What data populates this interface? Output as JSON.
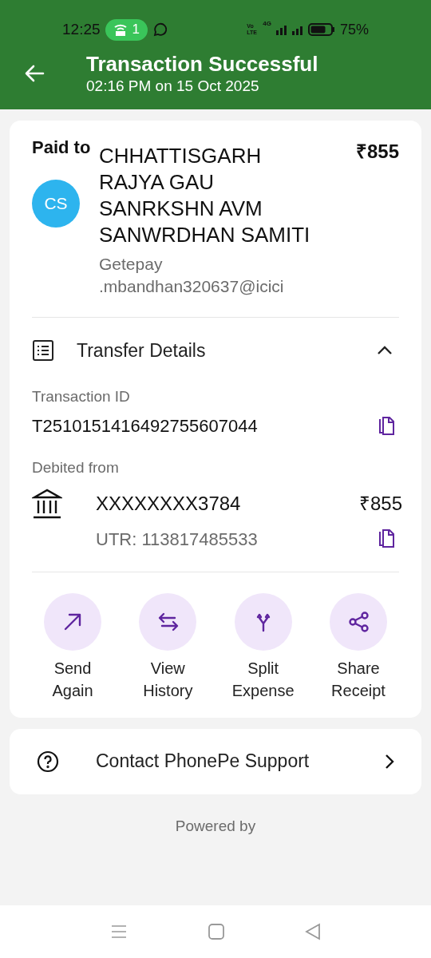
{
  "status_bar": {
    "time": "12:25",
    "hotspot_count": "1",
    "volte": "Vo LTE",
    "network": "4G",
    "battery": "75%"
  },
  "header": {
    "title": "Transaction Successful",
    "subtitle": "02:16 PM on 15 Oct 2025"
  },
  "payee": {
    "label": "Paid to",
    "initials": "CS",
    "name": "CHHATTISGARH RAJYA GAU SANRKSHN AVM SANWRDHAN SAMITI",
    "upi_id": "Getepay .mbandhan320637@icici",
    "amount": "₹855"
  },
  "transfer_details": {
    "title": "Transfer Details",
    "expanded": true,
    "transaction_id_label": "Transaction ID",
    "transaction_id": "T2510151416492755607044",
    "debited_label": "Debited from",
    "account": "XXXXXXXX3784",
    "amount": "₹855",
    "utr": "UTR: 113817485533"
  },
  "actions": [
    {
      "kind": "send",
      "label": "Send Again"
    },
    {
      "kind": "history",
      "label": "View History"
    },
    {
      "kind": "split",
      "label": "Split Expense"
    },
    {
      "kind": "share",
      "label": "Share Receipt"
    }
  ],
  "support": {
    "label": "Contact PhonePe Support"
  },
  "footer": {
    "text": "Powered by"
  }
}
